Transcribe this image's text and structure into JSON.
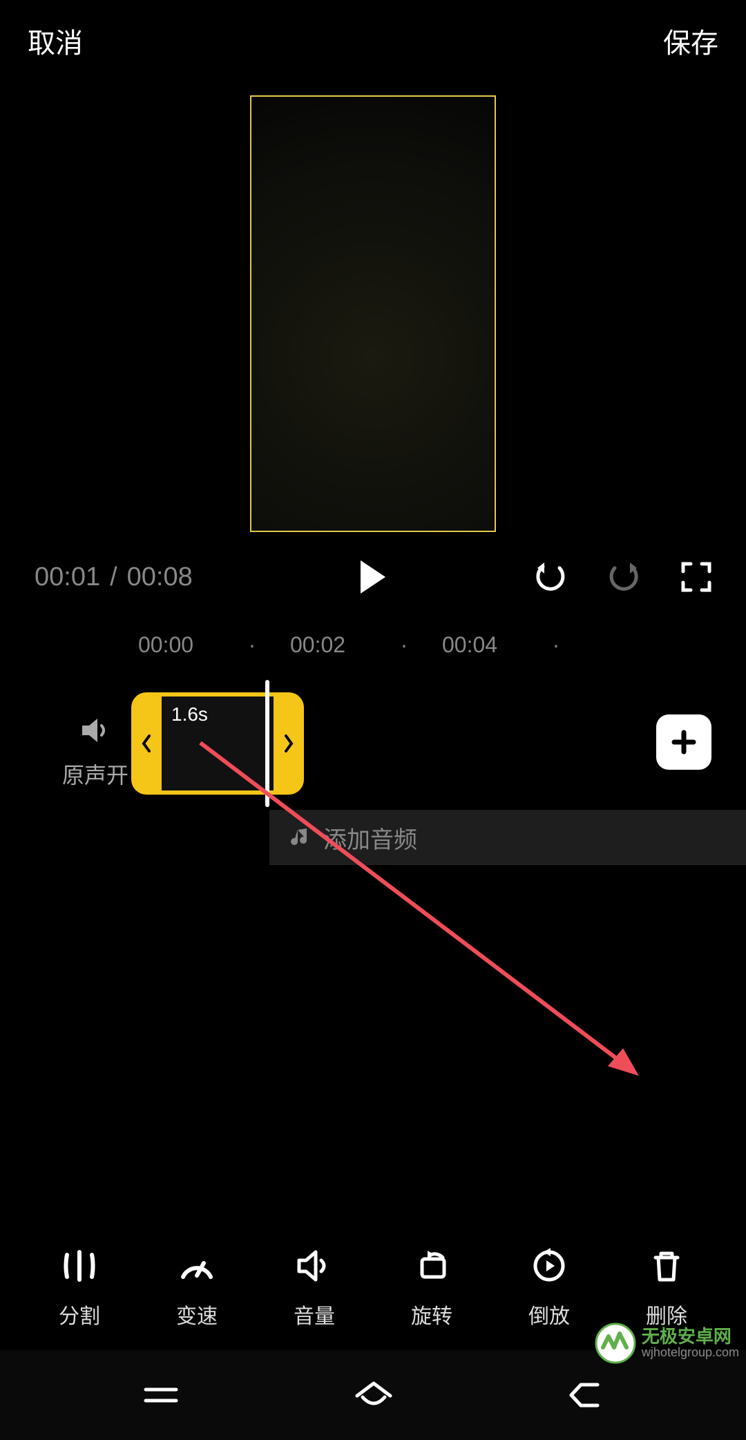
{
  "header": {
    "cancel": "取消",
    "save": "保存"
  },
  "playback": {
    "current_time": "00:01",
    "separator": "/",
    "total_time": "00:08"
  },
  "ruler": {
    "t0": "00:00",
    "t1": "00:02",
    "t2": "00:04",
    "dot": "·"
  },
  "sound": {
    "label": "原声开"
  },
  "clip": {
    "duration": "1.6s"
  },
  "audio": {
    "add_label": "添加音频"
  },
  "tools": {
    "split": "分割",
    "speed": "变速",
    "volume": "音量",
    "rotate": "旋转",
    "reverse": "倒放",
    "delete": "删除"
  },
  "watermark": {
    "title": "无极安卓网",
    "url": "wjhotelgroup.com"
  },
  "colors": {
    "accent": "#f5c518"
  }
}
